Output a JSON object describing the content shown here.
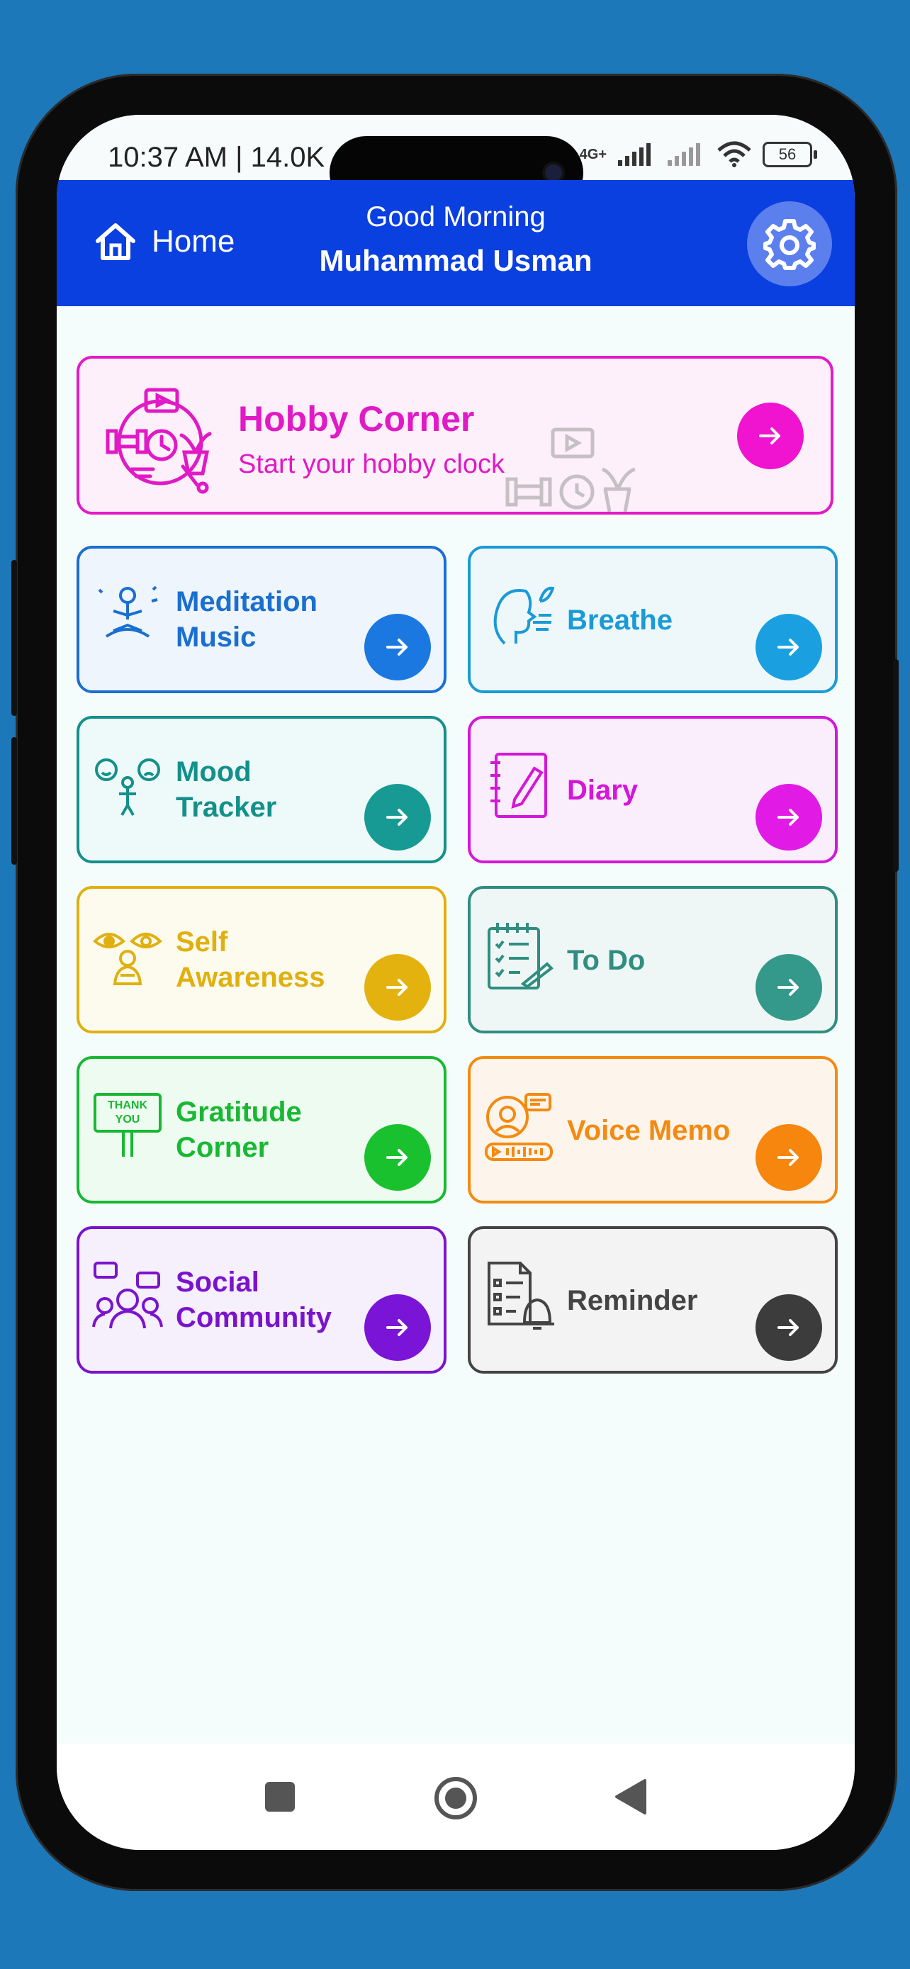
{
  "status": {
    "time": "10:37 AM | 14.0K",
    "network": "4G+",
    "battery": "56"
  },
  "header": {
    "home_label": "Home",
    "greeting": "Good Morning",
    "user_name": "Muhammad Usman"
  },
  "hobby_card": {
    "title": "Hobby Corner",
    "subtitle": "Start your hobby clock",
    "color": "#e01ac5"
  },
  "cards": [
    {
      "label": "Meditation Music",
      "color": "#1a6fd0",
      "arrow": "#1a78e0",
      "bg": "#eef5fc"
    },
    {
      "label": "Breathe",
      "color": "#1a9ad6",
      "arrow": "#1aa0e0",
      "bg": "#eef8fb"
    },
    {
      "label": "Mood Tracker",
      "color": "#14908a",
      "arrow": "#179a93",
      "bg": "#eefafa"
    },
    {
      "label": "Diary",
      "color": "#d417d9",
      "arrow": "#e11ae6",
      "bg": "#fbeefc"
    },
    {
      "label": "Self Awareness",
      "color": "#e0b010",
      "arrow": "#e3b20f",
      "bg": "#fdfbee"
    },
    {
      "label": "To Do",
      "color": "#2f8e80",
      "arrow": "#34998a",
      "bg": "#eff7f6"
    },
    {
      "label": "Gratitude Corner",
      "color": "#18b833",
      "arrow": "#1ac12e",
      "bg": "#eefbf0"
    },
    {
      "label": "Voice Memo",
      "color": "#f38a12",
      "arrow": "#f7860f",
      "bg": "#fdf5ec"
    },
    {
      "label": "Social Community",
      "color": "#7a14cc",
      "arrow": "#7a14d6",
      "bg": "#f6effc"
    },
    {
      "label": "Reminder",
      "color": "#444444",
      "arrow": "#3c3c3c",
      "bg": "#f3f3f3"
    }
  ],
  "icons": {
    "home": "home-icon",
    "settings": "gear-icon",
    "arrow": "arrow-right-icon",
    "nav": [
      "square-icon",
      "circle-icon",
      "back-triangle-icon"
    ]
  }
}
